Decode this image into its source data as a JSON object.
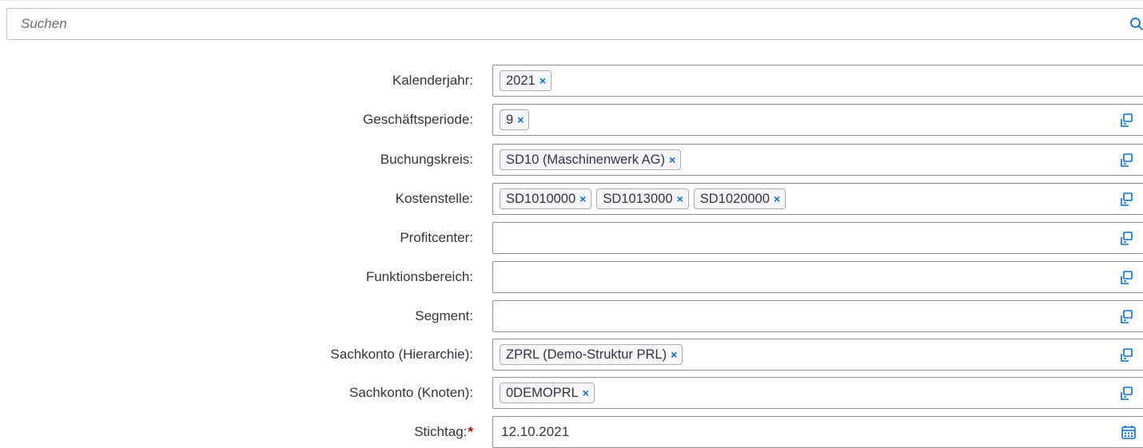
{
  "search": {
    "placeholder": "Suchen",
    "value": ""
  },
  "filters": {
    "kalenderjahr": {
      "label": "Kalenderjahr:",
      "tokens": [
        "2021"
      ]
    },
    "geschaeftsperiode": {
      "label": "Geschäftsperiode:",
      "tokens": [
        "9"
      ]
    },
    "buchungskreis": {
      "label": "Buchungskreis:",
      "tokens": [
        "SD10 (Maschinenwerk AG)"
      ]
    },
    "kostenstelle": {
      "label": "Kostenstelle:",
      "tokens": [
        "SD1010000",
        "SD1013000",
        "SD1020000"
      ]
    },
    "profitcenter": {
      "label": "Profitcenter:",
      "tokens": []
    },
    "funktionsbereich": {
      "label": "Funktionsbereich:",
      "tokens": []
    },
    "segment": {
      "label": "Segment:",
      "tokens": []
    },
    "sachkonto_hierarchie": {
      "label": "Sachkonto (Hierarchie):",
      "tokens": [
        "ZPRL (Demo-Struktur PRL)"
      ]
    },
    "sachkonto_knoten": {
      "label": "Sachkonto (Knoten):",
      "tokens": [
        "0DEMOPRL"
      ]
    },
    "stichtag": {
      "label": "Stichtag:",
      "required_marker": "*",
      "value": "12.10.2021"
    }
  },
  "token_remove_glyph": "×",
  "icons": {
    "search": "search-icon",
    "value_help": "value-help-icon",
    "calendar": "calendar-icon"
  },
  "colors": {
    "accent": "#0a6ed1",
    "required": "#bb0000",
    "text": "#32363a",
    "field_border": "#89919a"
  }
}
